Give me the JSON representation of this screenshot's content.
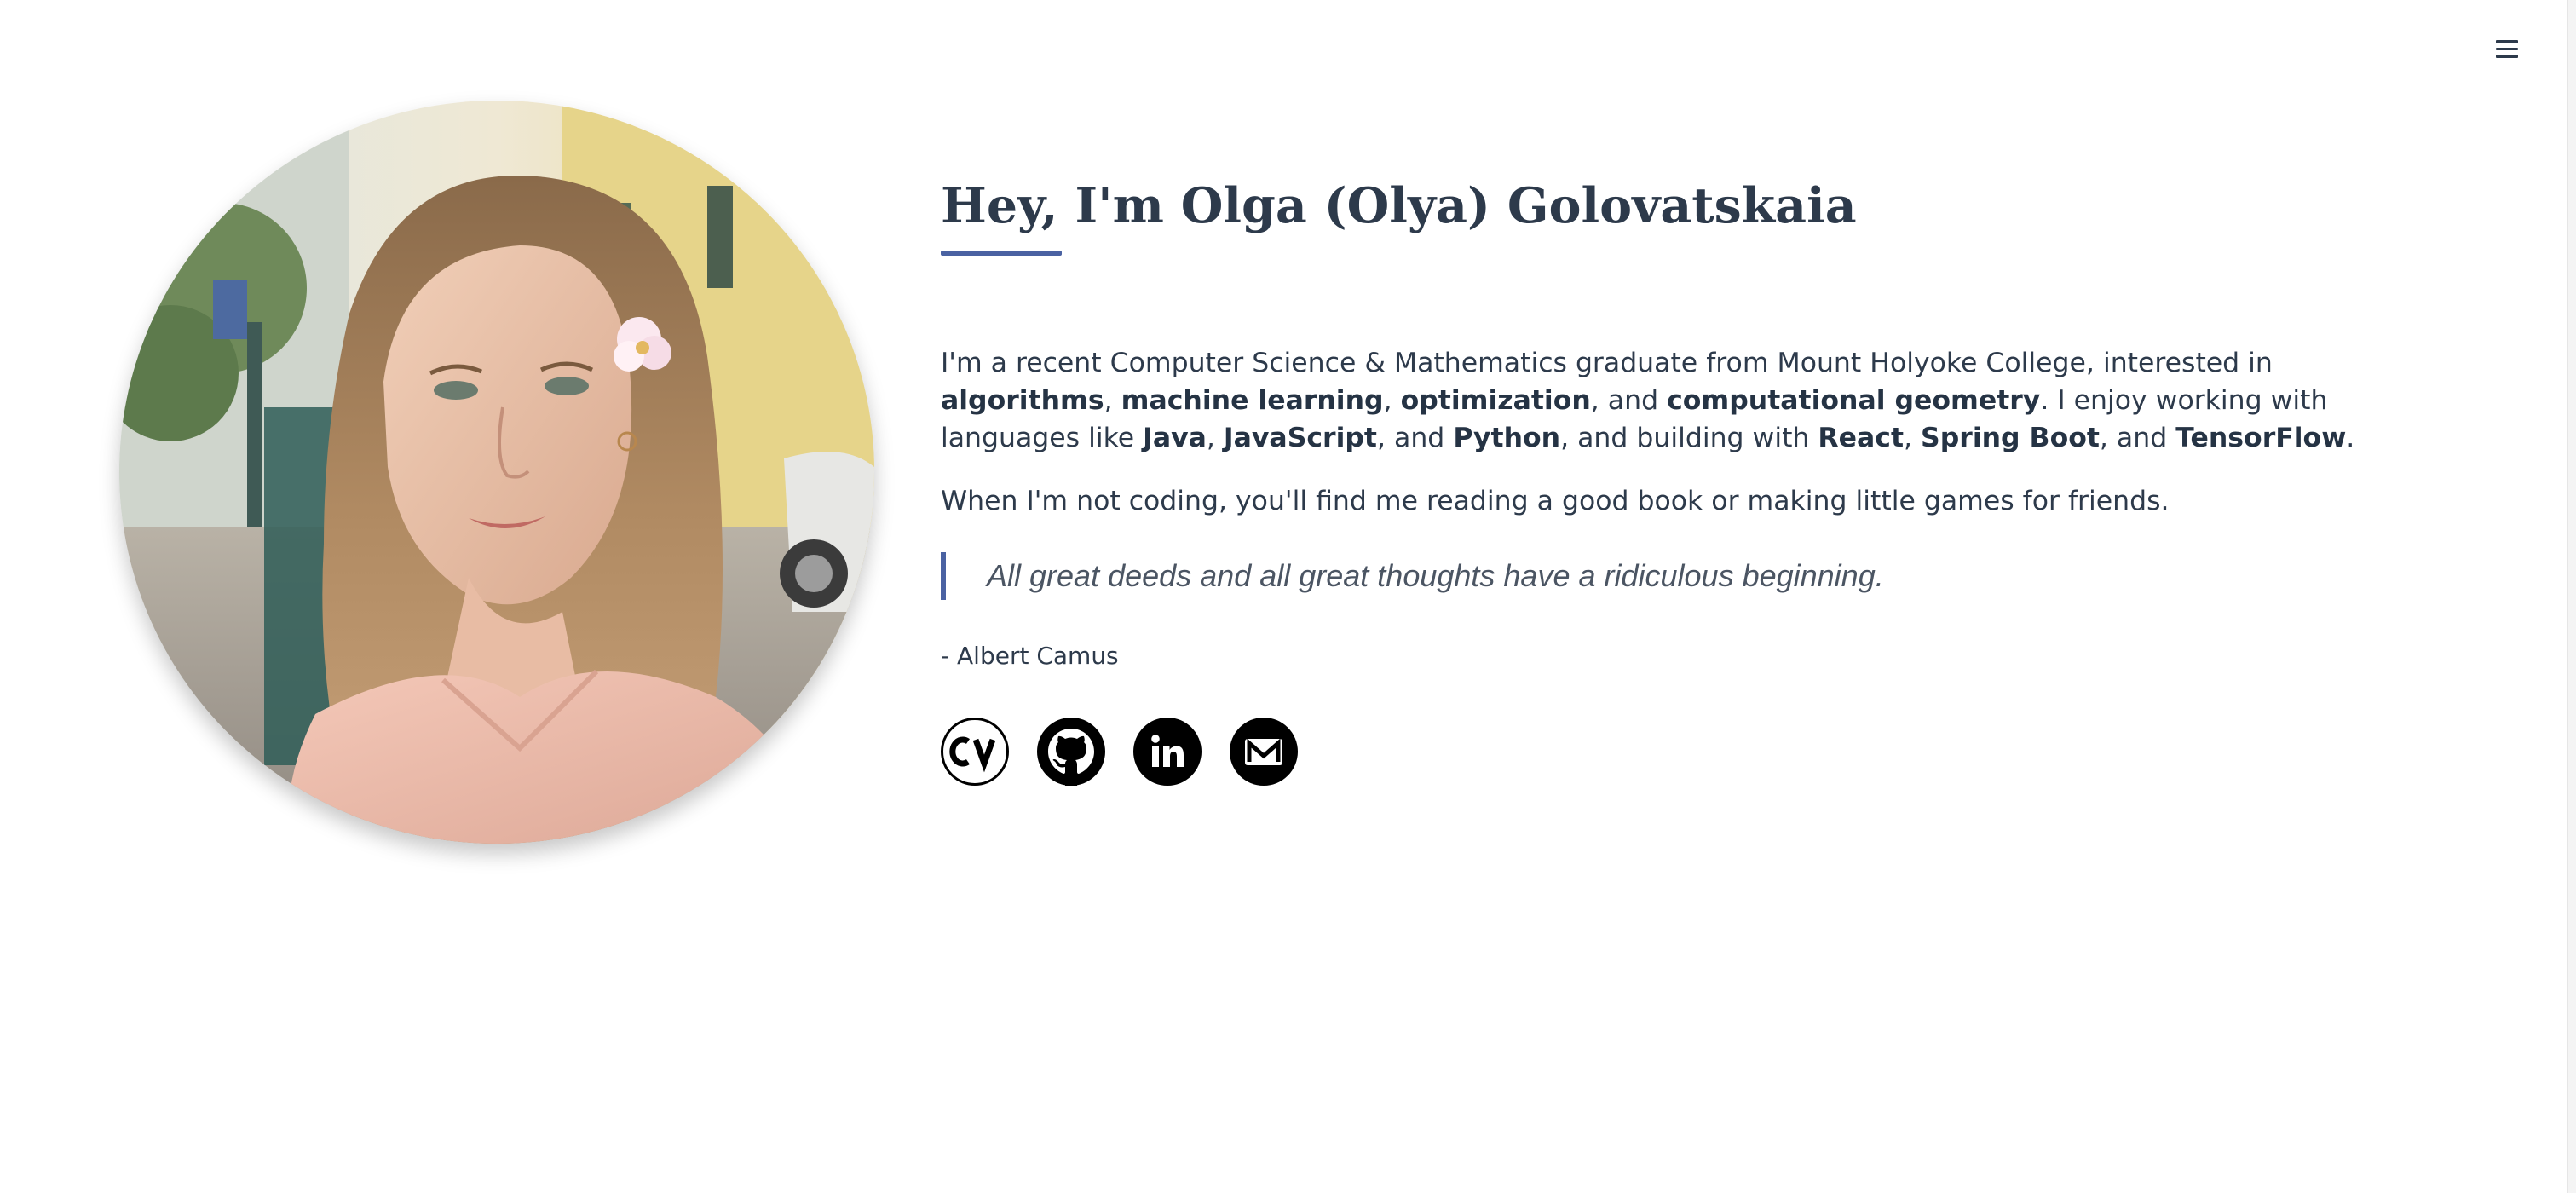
{
  "nav": {
    "menu_icon": "hamburger-menu-icon"
  },
  "hero": {
    "title": "Hey, I'm Olga (Olya) Golovatskaia",
    "portrait_alt": "Portrait of Olga Golovatskaia",
    "bio": {
      "t1": "I'm a recent Computer Science & Mathematics graduate from Mount Holyoke College, interested in ",
      "k1": "algorithms",
      "t2": ", ",
      "k2": "machine learning",
      "t3": ", ",
      "k3": "optimization",
      "t4": ", and ",
      "k4": "computational geometry",
      "t5": ". I enjoy working with languages like ",
      "k5": "Java",
      "t6": ", ",
      "k6": "JavaScript",
      "t7": ", and ",
      "k7": "Python",
      "t8": ", and building with ",
      "k8": "React",
      "t9": ", ",
      "k9": "Spring Boot",
      "t10": ", and ",
      "k10": "TensorFlow",
      "t11": "."
    },
    "hobby": "When I'm not coding, you'll find me reading a good book or making little games for friends.",
    "quote": "All great deeds and all great thoughts have a ridiculous beginning.",
    "quote_author": "- Albert Camus"
  },
  "socials": [
    {
      "name": "cv",
      "icon": "cv-icon"
    },
    {
      "name": "github",
      "icon": "github-icon"
    },
    {
      "name": "linkedin",
      "icon": "linkedin-icon"
    },
    {
      "name": "email",
      "icon": "mail-icon"
    }
  ],
  "colors": {
    "text": "#2d3a4b",
    "accent": "#4a62a2",
    "quote": "#4b5563"
  }
}
